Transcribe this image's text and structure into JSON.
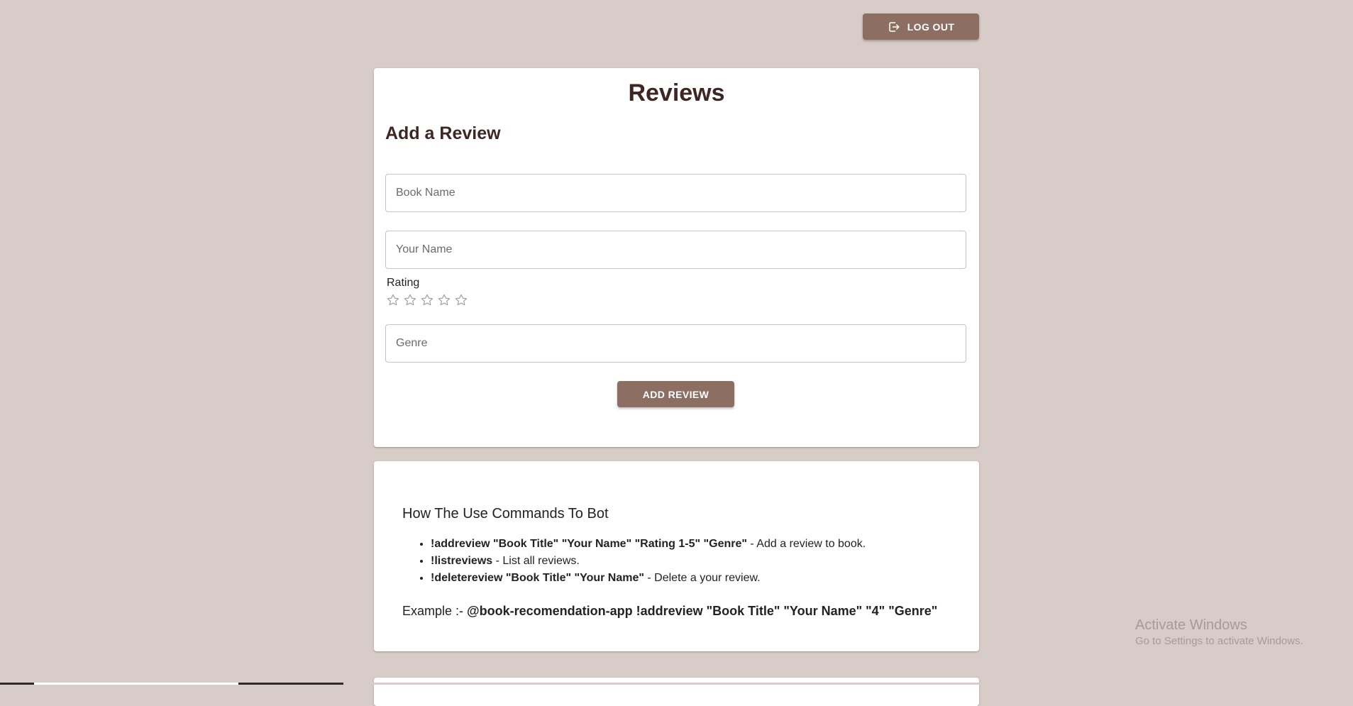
{
  "header": {
    "logout_label": "LOG OUT",
    "logout_icon": "logout-icon"
  },
  "review_form": {
    "title": "Reviews",
    "subtitle": "Add a Review",
    "book_name_placeholder": "Book Name",
    "your_name_placeholder": "Your Name",
    "rating_label": "Rating",
    "rating_value": 0,
    "rating_max": 5,
    "genre_placeholder": "Genre",
    "submit_label": "ADD REVIEW"
  },
  "commands": {
    "title": "How The Use Commands To Bot",
    "items": [
      {
        "command": "!addreview \"Book Title\" \"Your Name\" \"Rating 1-5\" \"Genre\"",
        "description": " - Add a review to book."
      },
      {
        "command": "!listreviews",
        "description": " - List all reviews."
      },
      {
        "command": "!deletereview \"Book Title\" \"Your Name\"",
        "description": " - Delete a your review."
      }
    ],
    "example_prefix": "Example :- ",
    "example_command": "@book-recomendation-app !addreview \"Book Title\" \"Your Name\" \"4\" \"Genre\""
  },
  "watermark": {
    "title": "Activate Windows",
    "subtitle": "Go to Settings to activate Windows."
  },
  "colors": {
    "background": "#d7ccc8",
    "button": "#8d6e63",
    "heading": "#3e2723",
    "card": "#ffffff"
  }
}
